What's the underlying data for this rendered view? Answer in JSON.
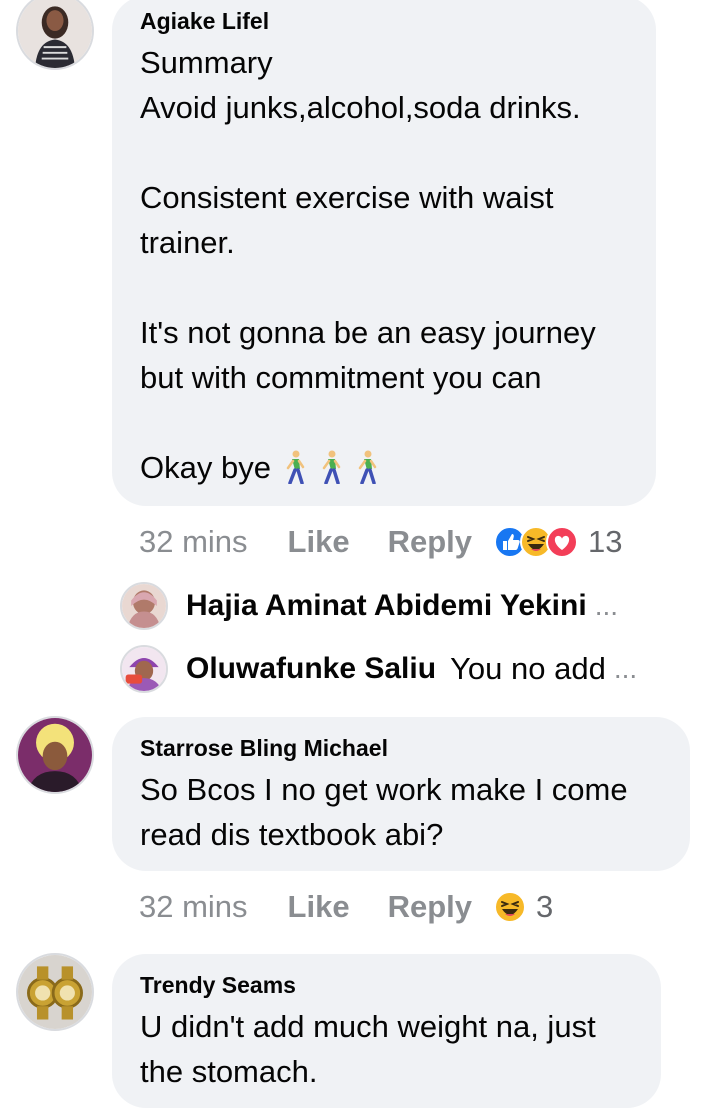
{
  "comments": [
    {
      "author": "Agiake Lifel",
      "body": "Summary\nAvoid junks,alcohol,soda drinks.\n\nConsistent exercise with waist\ntrainer.\n\nIt's not gonna be an easy journey\nbut with commitment you can\n\nOkay bye",
      "trailing_icons": [
        "person-walking-icon",
        "person-walking-icon",
        "person-walking-icon"
      ],
      "time": "32 mins",
      "like_label": "Like",
      "reply_label": "Reply",
      "reactions": [
        "like-reaction-icon",
        "haha-reaction-icon",
        "love-reaction-icon"
      ],
      "reaction_count": "13",
      "replies": [
        {
          "name": "Hajia Aminat Abidemi Yekini",
          "text": "",
          "more": "..."
        },
        {
          "name": "Oluwafunke Saliu",
          "text": "You no add",
          "more": "..."
        }
      ]
    },
    {
      "author": "Starrose Bling Michael",
      "body": "So Bcos I no get work make I come\nread dis textbook abi?",
      "time": "32 mins",
      "like_label": "Like",
      "reply_label": "Reply",
      "reactions": [
        "haha-reaction-icon"
      ],
      "reaction_count": "3"
    },
    {
      "author": "Trendy Seams",
      "body": "U didn't add much weight na, just\nthe stomach."
    }
  ],
  "colors": {
    "bubble_bg": "#f0f2f5",
    "meta_text": "#8a8d91",
    "like_blue": "#1877f2",
    "love_red": "#f33e58",
    "haha_yellow": "#f7b928"
  }
}
